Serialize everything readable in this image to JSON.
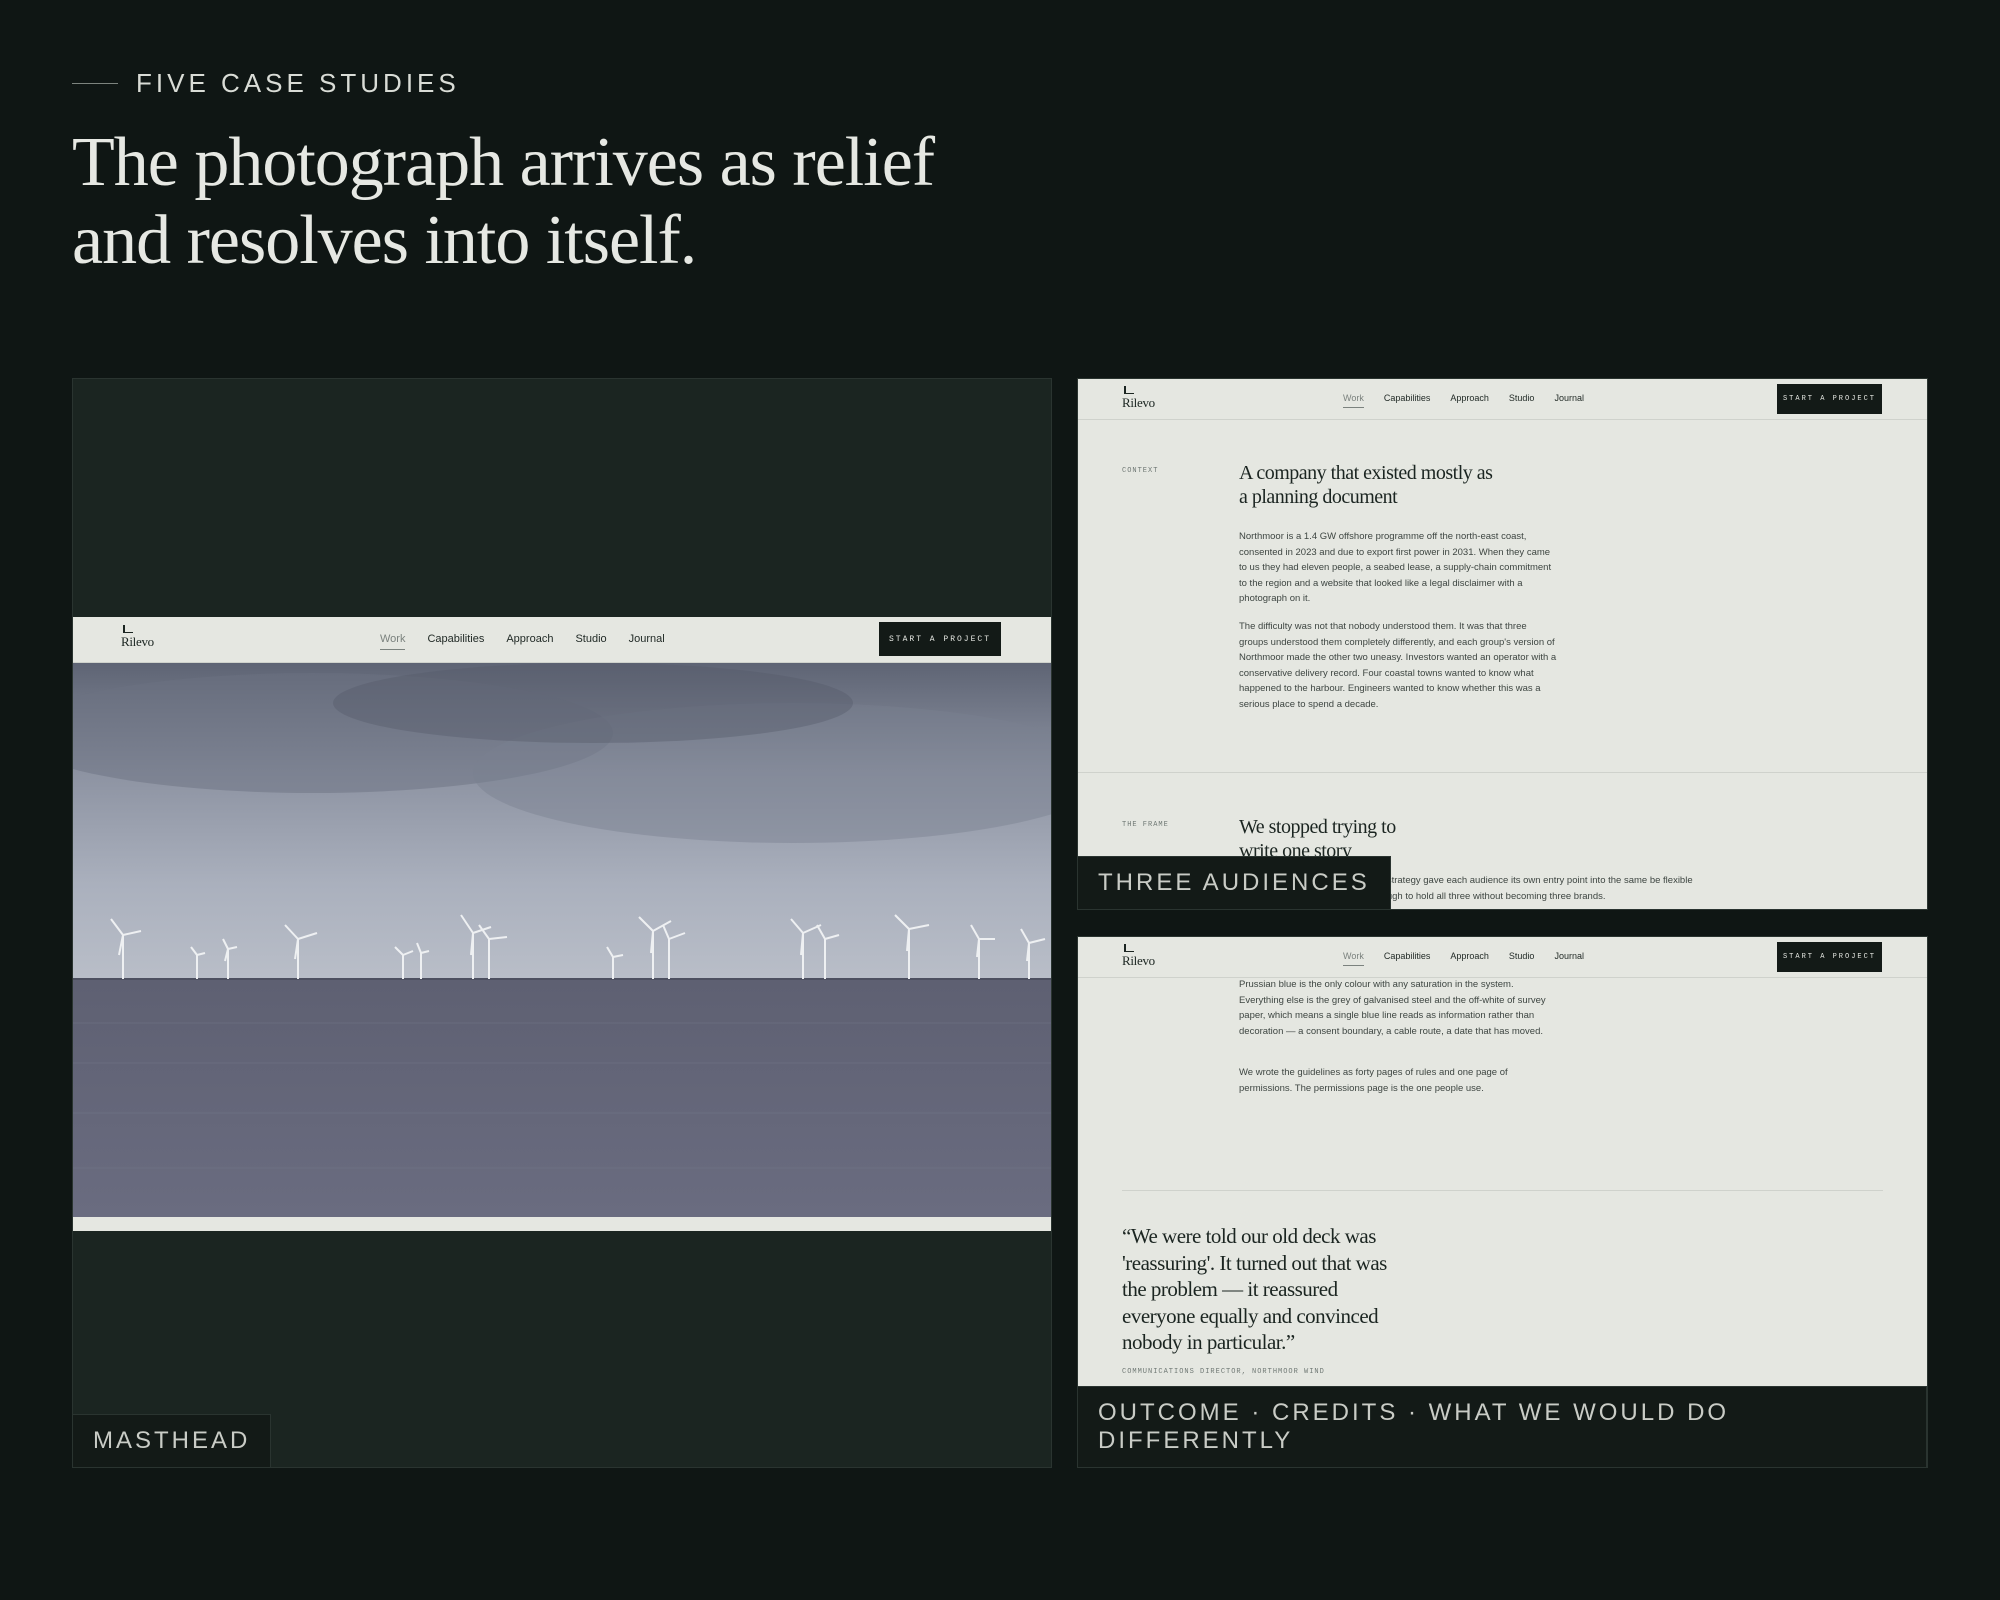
{
  "header": {
    "eyebrow": "FIVE CASE STUDIES",
    "headline": "The photograph arrives as relief and resolves into itself."
  },
  "site": {
    "logo": "Rilevo",
    "nav": [
      "Work",
      "Capabilities",
      "Approach",
      "Studio",
      "Journal"
    ],
    "cta": "START A PROJECT"
  },
  "panels": {
    "masthead": {
      "label": "MASTHEAD"
    },
    "three_audiences": {
      "label": "THREE AUDIENCES",
      "context_label": "CONTEXT",
      "context_heading": "A company that existed mostly as a planning document",
      "context_p1": "Northmoor is a 1.4 GW offshore programme off the north-east coast, consented in 2023 and due to export first power in 2031. When they came to us they had eleven people, a seabed lease, a supply-chain commitment to the region and a website that looked like a legal disclaimer with a photograph on it.",
      "context_p2": "The difficulty was not that nobody understood them. It was that three groups understood them completely differently, and each group's version of Northmoor made the other two uneasy. Investors wanted an operator with a conservative delivery record. Four coastal towns wanted to know what happened to the harbour. Engineers wanted to know whether this was a serious place to spend a decade.",
      "frame_label": "THE FRAME",
      "frame_heading": "We stopped trying to write one story",
      "frame_p": "the strategy gave each audience its own entry point into the same be flexible enough to hold all three without becoming three brands."
    },
    "outcome": {
      "label": "OUTCOME · CREDITS · WHAT WE WOULD DO DIFFERENTLY",
      "p1": "Prussian blue is the only colour with any saturation in the system. Everything else is the grey of galvanised steel and the off-white of survey paper, which means a single blue line reads as information rather than decoration — a consent boundary, a cable route, a date that has moved.",
      "p2": "We wrote the guidelines as forty pages of rules and one page of permissions. The permissions page is the one people use.",
      "quote": "“We were told our old deck was 'reassuring'. It turned out that was the problem — it reassured everyone equally and convinced nobody in particular.”",
      "attribution": "COMMUNICATIONS DIRECTOR, NORTHMOOR WIND"
    }
  },
  "colors": {
    "page_bg": "#0f1614",
    "panel_dark": "#1b2521",
    "paper": "#e5e7e1",
    "ink": "#1b2521"
  }
}
